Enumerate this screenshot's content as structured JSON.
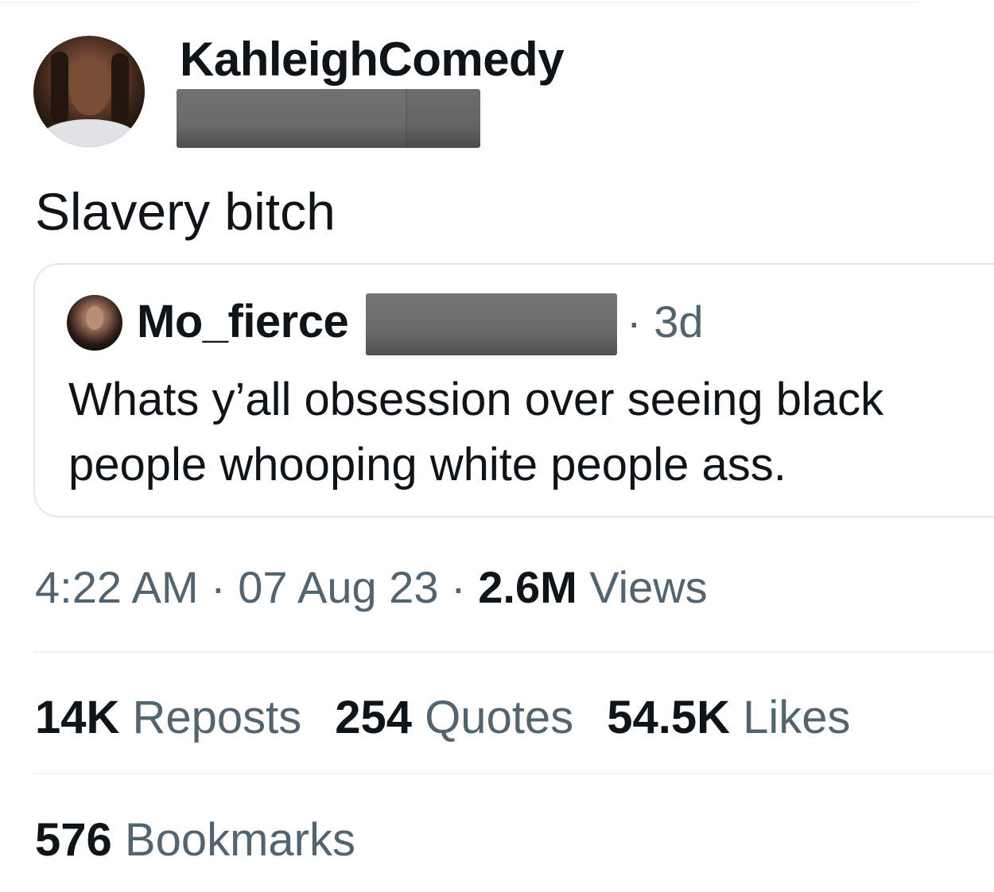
{
  "author": {
    "display_name": "KahleighComedy",
    "avatar_icon": "user-avatar-photo"
  },
  "tweet": {
    "text": "Slavery bitch"
  },
  "quoted_tweet": {
    "author_name": "Mo_fierce",
    "avatar_icon": "user-avatar-photo",
    "time": "· 3d",
    "text": "Whats y’all obsession over seeing black people whooping white people ass."
  },
  "meta": {
    "time": "4:22 AM",
    "sep1": " · ",
    "date": "07 Aug 23",
    "sep2": " · ",
    "views_count": "2.6M",
    "views_label": " Views"
  },
  "stats": {
    "reposts_count": "14K",
    "reposts_label": " Reposts",
    "quotes_count": "254",
    "quotes_label": " Quotes",
    "likes_count": "54.5K",
    "likes_label": " Likes",
    "bookmarks_count": "576",
    "bookmarks_label": " Bookmarks"
  },
  "colors": {
    "primary_text": "#0f1419",
    "secondary_text": "#536471",
    "border": "#eff3f4",
    "redaction": "#6b6b6b"
  }
}
